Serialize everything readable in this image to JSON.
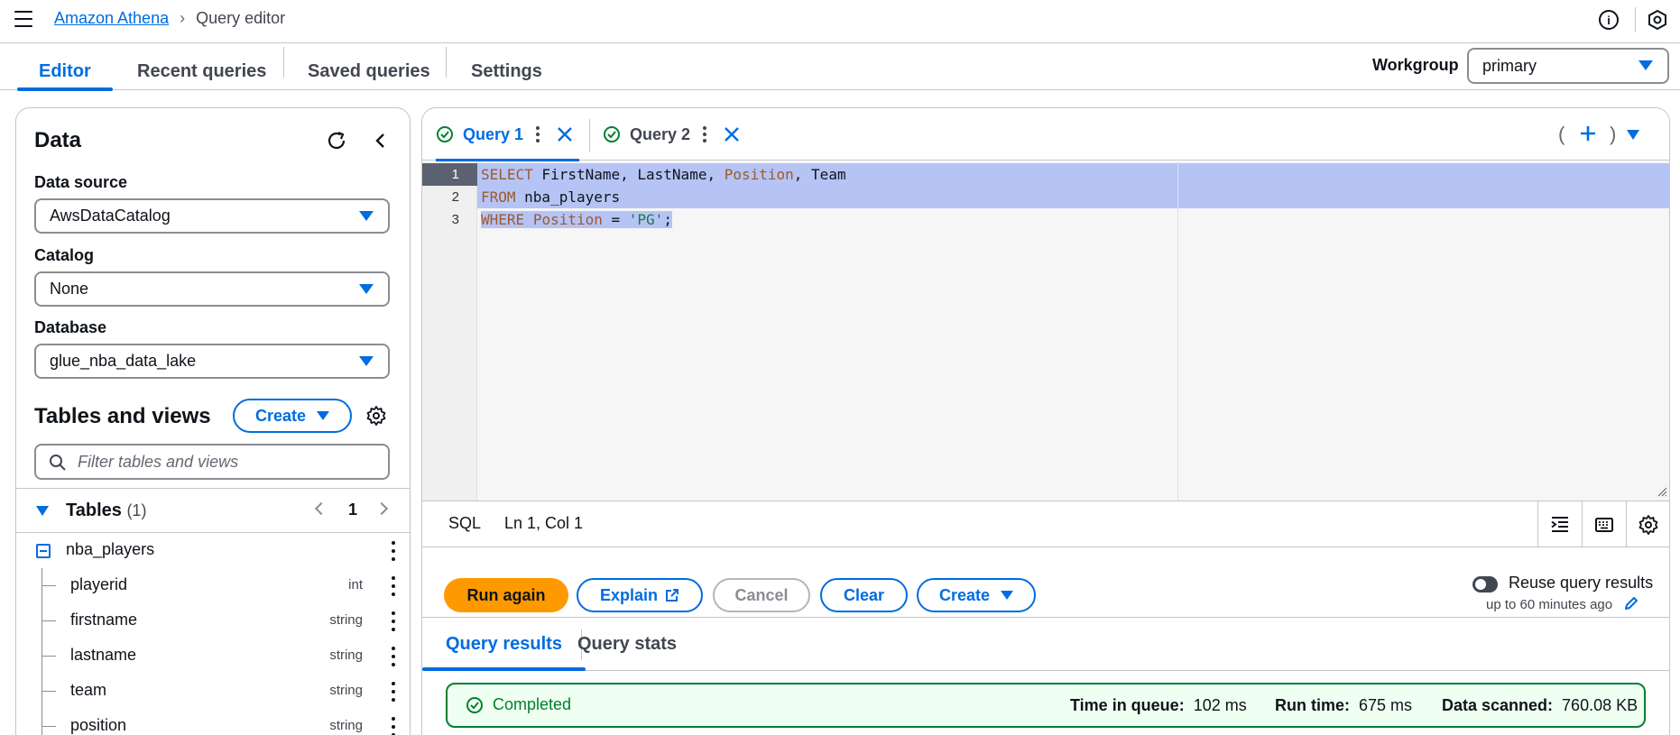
{
  "topbar": {
    "breadcrumb_root": "Amazon Athena",
    "breadcrumb_current": "Query editor",
    "info_icon": "info-icon",
    "notifications_icon": "notifications-icon"
  },
  "tabs": {
    "editor": "Editor",
    "recent": "Recent queries",
    "saved": "Saved queries",
    "settings": "Settings"
  },
  "workgroup": {
    "label": "Workgroup",
    "value": "primary"
  },
  "data_panel": {
    "title": "Data",
    "data_source_label": "Data source",
    "data_source_value": "AwsDataCatalog",
    "catalog_label": "Catalog",
    "catalog_value": "None",
    "database_label": "Database",
    "database_value": "glue_nba_data_lake",
    "tables_views_title": "Tables and views",
    "create_label": "Create",
    "filter_placeholder": "Filter tables and views",
    "tables_label": "Tables",
    "tables_count": "(1)",
    "page_number": "1",
    "table_name": "nba_players",
    "columns": [
      {
        "name": "playerid",
        "type": "int"
      },
      {
        "name": "firstname",
        "type": "string"
      },
      {
        "name": "lastname",
        "type": "string"
      },
      {
        "name": "team",
        "type": "string"
      },
      {
        "name": "position",
        "type": "string"
      }
    ]
  },
  "editor": {
    "query_tabs": [
      {
        "label": "Query 1",
        "active": true
      },
      {
        "label": "Query 2",
        "active": false
      }
    ],
    "add_open": "(",
    "add_close": ")",
    "lines": [
      {
        "num": "1",
        "kw": "SELECT",
        "rest": " FirstName, LastName, ",
        "kw2": "Position",
        "rest2": ", Team"
      },
      {
        "num": "2",
        "kw": "FROM",
        "rest": " nba_players",
        "kw2": "",
        "rest2": ""
      },
      {
        "num": "3",
        "kw": "WHERE",
        "rest": " ",
        "kw2": "Position",
        "rest2": " = ",
        "str": "'PG'",
        "tail": ";"
      }
    ],
    "language": "SQL",
    "cursor": "Ln 1, Col 1"
  },
  "actions": {
    "run_again": "Run again",
    "explain": "Explain",
    "cancel": "Cancel",
    "clear": "Clear",
    "create": "Create",
    "reuse_label": "Reuse query results",
    "reuse_sub": "up to 60 minutes ago"
  },
  "results": {
    "tab_results": "Query results",
    "tab_stats": "Query stats",
    "status": "Completed",
    "time_in_queue_label": "Time in queue:",
    "time_in_queue_value": "102 ms",
    "run_time_label": "Run time:",
    "run_time_value": "675 ms",
    "data_scanned_label": "Data scanned:",
    "data_scanned_value": "760.08 KB"
  },
  "colors": {
    "accent": "#006ce0",
    "primary_button": "#ff9900",
    "success": "#00802f",
    "selection": "#b5c4f5"
  }
}
